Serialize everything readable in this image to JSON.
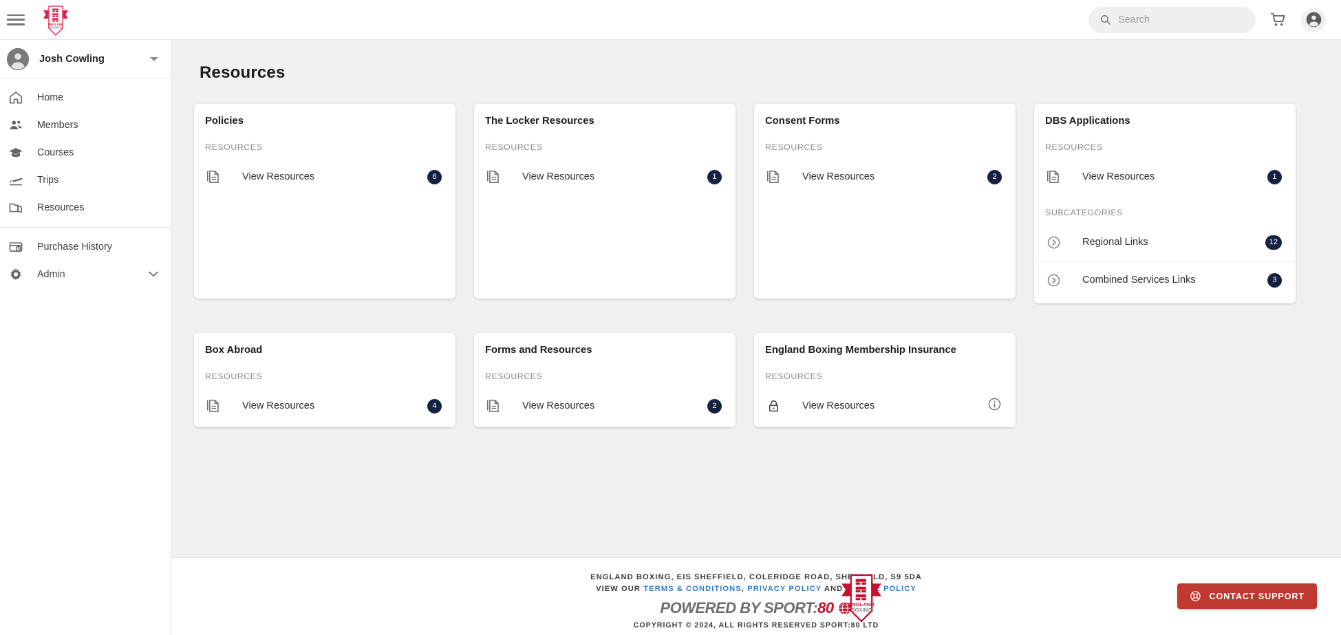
{
  "topbar": {
    "menu_icon": "hamburger-menu-icon",
    "logo_alt": "England Boxing",
    "search": {
      "value": "",
      "placeholder": "Search"
    },
    "cart_icon": "shopping-cart-icon",
    "account_icon": "account-circle-icon"
  },
  "sidebar": {
    "user": {
      "name": "Josh Cowling",
      "avatar_icon": "user-avatar-icon",
      "caret_icon": "caret-down-icon"
    },
    "groups": [
      {
        "items": [
          {
            "label": "Home",
            "icon": "home-icon",
            "has_chevron": false
          },
          {
            "label": "Members",
            "icon": "people-icon",
            "has_chevron": false
          },
          {
            "label": "Courses",
            "icon": "graduation-cap-icon",
            "has_chevron": false
          },
          {
            "label": "Trips",
            "icon": "flight-takeoff-icon",
            "has_chevron": false
          },
          {
            "label": "Resources",
            "icon": "folder-copy-icon",
            "has_chevron": false
          }
        ]
      },
      {
        "items": [
          {
            "label": "Purchase History",
            "icon": "receipt-clock-icon",
            "has_chevron": false
          },
          {
            "label": "Admin",
            "icon": "gear-icon",
            "has_chevron": true
          }
        ]
      }
    ]
  },
  "main": {
    "page_title": "Resources",
    "section_labels": {
      "resources": "RESOURCES",
      "subcategories": "SUBCATEGORIES"
    },
    "cards": [
      {
        "title": "Policies",
        "resources_label": "RESOURCES",
        "rows": [
          {
            "label": "View Resources",
            "icon": "document-stack-icon",
            "badge": "6",
            "locked": false
          }
        ],
        "subcategories_label": null,
        "subcategories": []
      },
      {
        "title": "The Locker Resources",
        "resources_label": "RESOURCES",
        "rows": [
          {
            "label": "View Resources",
            "icon": "document-stack-icon",
            "badge": "1",
            "locked": false
          }
        ],
        "subcategories_label": null,
        "subcategories": []
      },
      {
        "title": "Consent Forms",
        "resources_label": "RESOURCES",
        "rows": [
          {
            "label": "View Resources",
            "icon": "document-stack-icon",
            "badge": "2",
            "locked": false
          }
        ],
        "subcategories_label": null,
        "subcategories": []
      },
      {
        "title": "DBS Applications",
        "resources_label": "RESOURCES",
        "rows": [
          {
            "label": "View Resources",
            "icon": "document-stack-icon",
            "badge": "1",
            "locked": false
          }
        ],
        "subcategories_label": "SUBCATEGORIES",
        "subcategories": [
          {
            "label": "Regional Links",
            "icon": "chevron-circle-right-icon",
            "badge": "12"
          },
          {
            "label": "Combined Services Links",
            "icon": "chevron-circle-right-icon",
            "badge": "3"
          }
        ]
      },
      {
        "title": "Box Abroad",
        "resources_label": "RESOURCES",
        "rows": [
          {
            "label": "View Resources",
            "icon": "document-stack-icon",
            "badge": "4",
            "locked": false
          }
        ],
        "subcategories_label": null,
        "subcategories": []
      },
      {
        "title": "Forms and Resources",
        "resources_label": "RESOURCES",
        "rows": [
          {
            "label": "View Resources",
            "icon": "document-stack-icon",
            "badge": "2",
            "locked": false
          }
        ],
        "subcategories_label": null,
        "subcategories": []
      },
      {
        "title": "England Boxing Membership Insurance",
        "resources_label": "RESOURCES",
        "rows": [
          {
            "label": "View Resources",
            "icon": "lock-icon",
            "badge": null,
            "locked": true,
            "info_icon": "info-circle-icon"
          }
        ],
        "subcategories_label": null,
        "subcategories": []
      }
    ]
  },
  "footer": {
    "address_strong": "ENGLAND BOXING",
    "address_rest": ", EIS SHEFFIELD, COLERIDGE ROAD, SHEFFIELD, S9 5DA",
    "view_our": "VIEW OUR ",
    "terms_link": "TERMS & CONDITIONS",
    "comma": ", ",
    "privacy_link": "PRIVACY POLICY",
    "and": " AND ",
    "cookie_link": "COOKIE POLICY",
    "powered_prefix": "POWERED BY SPORT:",
    "powered_suffix": "80",
    "copyright": "COPYRIGHT © 2024, ALL RIGHTS RESERVED SPORT:80 LTD",
    "logo_alt": "England Boxing",
    "support_button": "CONTACT SUPPORT",
    "support_icon": "lifebuoy-icon"
  },
  "colors": {
    "badge_navy": "#152142",
    "brand_red": "#c8102e",
    "support_red": "#c0392f",
    "link_blue": "#2f7ccc",
    "page_bg": "#f1f1f1"
  }
}
